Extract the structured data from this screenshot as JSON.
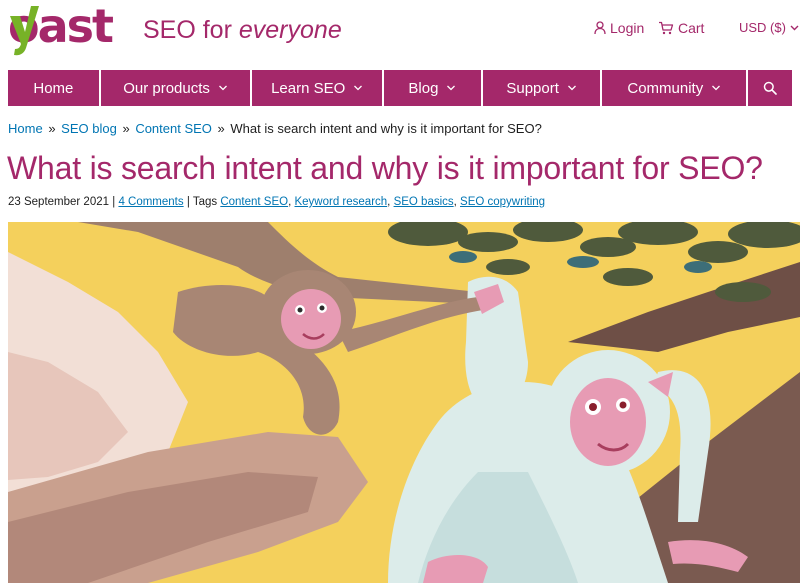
{
  "brand": {
    "logo_text": "yoast",
    "tagline_plain": "SEO for ",
    "tagline_italic": "everyone",
    "colors": {
      "primary": "#a4286a",
      "accent_green": "#77b227",
      "link": "#0075b3"
    }
  },
  "utility": {
    "login_label": "Login",
    "cart_label": "Cart",
    "currency_label": "USD ($)",
    "icons": {
      "login": "user-icon",
      "cart": "cart-icon",
      "currency": "chevron-down-icon"
    }
  },
  "nav": {
    "items": [
      {
        "label": "Home",
        "has_dropdown": false
      },
      {
        "label": "Our products",
        "has_dropdown": true
      },
      {
        "label": "Learn SEO",
        "has_dropdown": true
      },
      {
        "label": "Blog",
        "has_dropdown": true
      },
      {
        "label": "Support",
        "has_dropdown": true
      },
      {
        "label": "Community",
        "has_dropdown": true
      }
    ],
    "search_icon": "search-icon"
  },
  "breadcrumb": {
    "items": [
      "Home",
      "SEO blog",
      "Content SEO"
    ],
    "separator": "»",
    "current": "What is search intent and why is it important for SEO?"
  },
  "article": {
    "title": "What is search intent and why is it important for SEO?",
    "date": "23 September 2021",
    "divider": "|",
    "comments_link": "4 Comments",
    "tags_prefix": "Tags",
    "tags": [
      "Content SEO",
      "Keyword research",
      "SEO basics",
      "SEO copywriting"
    ],
    "hero_image": "illustration-two-monkeys-on-rocks-under-tree"
  }
}
